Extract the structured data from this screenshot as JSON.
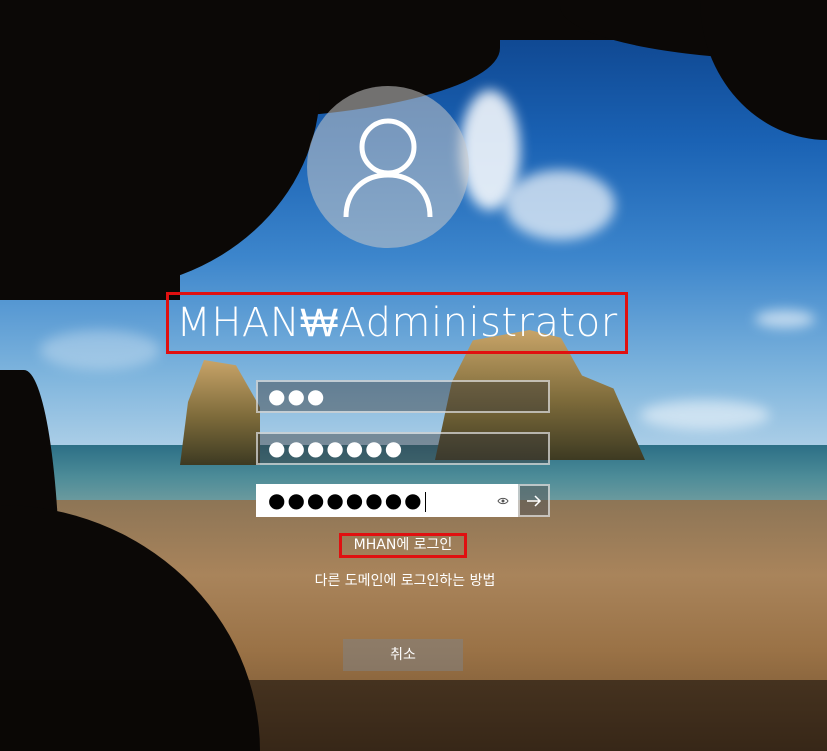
{
  "login": {
    "username": "MHAN₩Administrator",
    "fields": [
      {
        "value": "●●●"
      },
      {
        "value": "●●●●●●●"
      },
      {
        "value": "●●●●●●●●"
      }
    ],
    "domain_label": "MHAN에 로그인",
    "other_domain_link": "다른 도메인에 로그인하는 방법",
    "cancel_label": "취소"
  },
  "icons": {
    "avatar": "user-icon",
    "reveal": "eye-icon",
    "submit": "arrow-right-icon"
  },
  "colors": {
    "highlight": "#e01010"
  }
}
